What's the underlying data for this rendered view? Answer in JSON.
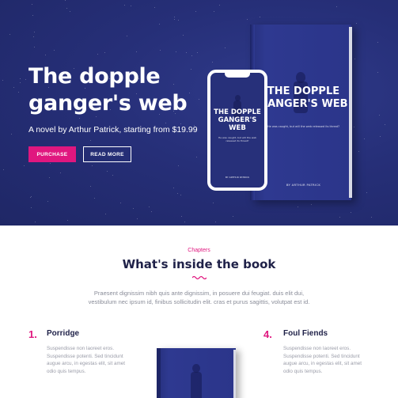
{
  "hero": {
    "title": "The dopple ganger's web",
    "subtitle": "A novel by Arthur Patrick, starting from $19.99",
    "purchase_label": "PURCHASE",
    "readmore_label": "READ MORE"
  },
  "phone_cover": {
    "title": "THE DOPPLE GANGER'S WEB",
    "tagline": "He was caught, but will the web released its threat?",
    "author": "BY ARTHUR PATRICK"
  },
  "book_cover": {
    "title": "THE DOPPLE GANGER'S WEB",
    "tagline": "He was caught, but will the web released its threat?",
    "author": "BY ARTHUR PATRICK"
  },
  "chapters": {
    "label": "Chapters",
    "title": "What's inside the book",
    "description": "Praesent dignissim nibh quis ante dignissim, in posuere dui feugiat. duis elit dui, vestibulum nec ipsum id, finibus sollicitudin elit. cras et purus sagittis, volutpat est id.",
    "items": [
      {
        "number": "1.",
        "title": "Porridge",
        "text": "Suspendisse non laoreet eros. Suspendisse potenti. Sed tincidunt augue arcu, in egestas elit, sit amet odio quis tempus."
      },
      {
        "number": "4.",
        "title": "Foul Fiends",
        "text": "Suspendisse non laoreet eros. Suspendisse potenti. Sed tincidunt augue arcu, in egestas elit, sit amet odio quis tempus."
      }
    ]
  },
  "colors": {
    "hero_bg": "#262f78",
    "accent": "#e0177f",
    "heading": "#1f2148",
    "muted_text": "#8a8d99"
  }
}
